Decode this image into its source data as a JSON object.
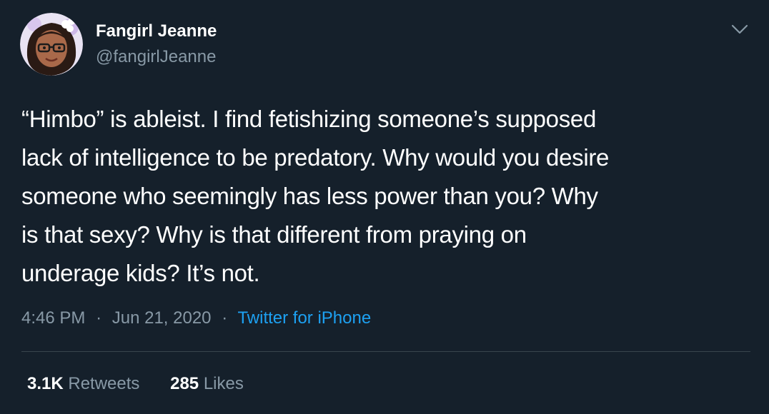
{
  "user": {
    "display_name": "Fangirl Jeanne",
    "handle": "@fangirlJeanne"
  },
  "tweet": {
    "lines": [
      "“Himbo” is ableist. I find fetishizing someone’s supposed",
      "lack of intelligence to be predatory. Why would you desire",
      "someone who seemingly has less power than you? Why",
      "is that sexy? Why is that different from praying on",
      "underage kids? It’s not."
    ],
    "time": "4:46 PM",
    "separator": "·",
    "date": "Jun 21, 2020",
    "source": "Twitter for iPhone"
  },
  "stats": {
    "retweets_count": "3.1K",
    "retweets_label": "Retweets",
    "likes_count": "285",
    "likes_label": "Likes"
  },
  "icons": {
    "avatar": "avatar-illustration",
    "menu": "chevron-down-icon"
  },
  "colors": {
    "background": "#15202b",
    "secondary_text": "#8899a6",
    "link": "#1da1f2",
    "divider": "#38444d"
  }
}
